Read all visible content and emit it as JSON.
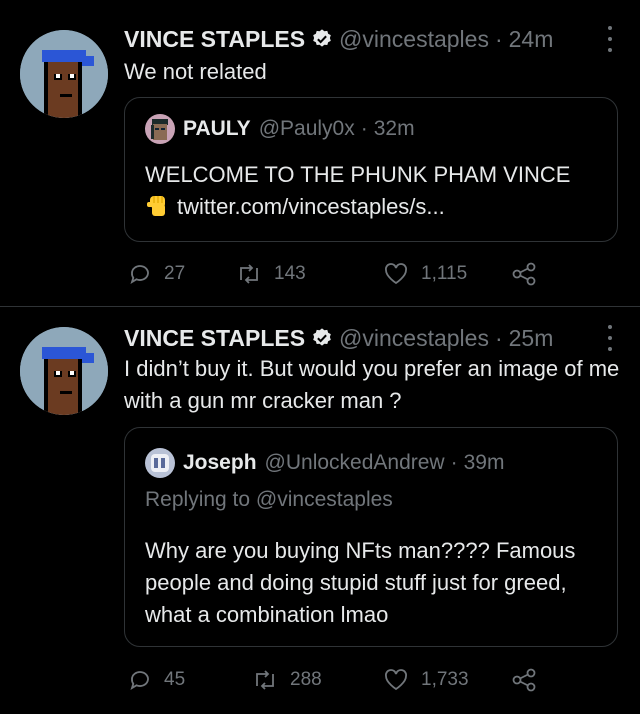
{
  "colors": {
    "background": "#000000",
    "text": "#e7e9ea",
    "muted": "#71767b",
    "border": "#2f3336",
    "verified": "#e7e9ea"
  },
  "tweets": [
    {
      "author": {
        "name": "VINCE STAPLES",
        "handle": "@vincestaples",
        "time": "24m",
        "avatar_icon": "pixel-punk-avatar"
      },
      "text": "We not related",
      "quote": {
        "author": {
          "name": "PAULY",
          "handle": "@Pauly0x",
          "time": "32m",
          "avatar_icon": "pixel-punk-avatar"
        },
        "text_line1": "WELCOME TO THE PHUNK PHAM VINCE",
        "emoji_icon": "raised-fist-emoji",
        "link": "twitter.com/vincestaples/s..."
      },
      "actions": {
        "replies": "27",
        "retweets": "143",
        "likes": "1,115"
      }
    },
    {
      "author": {
        "name": "VINCE STAPLES",
        "handle": "@vincestaples",
        "time": "25m",
        "avatar_icon": "pixel-punk-avatar"
      },
      "text": "I didn’t buy it. But would you prefer an image of me with a gun mr cracker man ?",
      "quote": {
        "author": {
          "name": "Joseph",
          "handle": "@UnlockedAndrew",
          "time": "39m",
          "avatar_icon": "profile-avatar"
        },
        "replying_label": "Replying to",
        "replying_to": "@vincestaples",
        "text": "Why are you buying NFts man???? Famous people and doing stupid stuff just for greed, what a combination lmao"
      },
      "actions": {
        "replies": "45",
        "retweets": "288",
        "likes": "1,733"
      }
    }
  ],
  "separator": "·"
}
